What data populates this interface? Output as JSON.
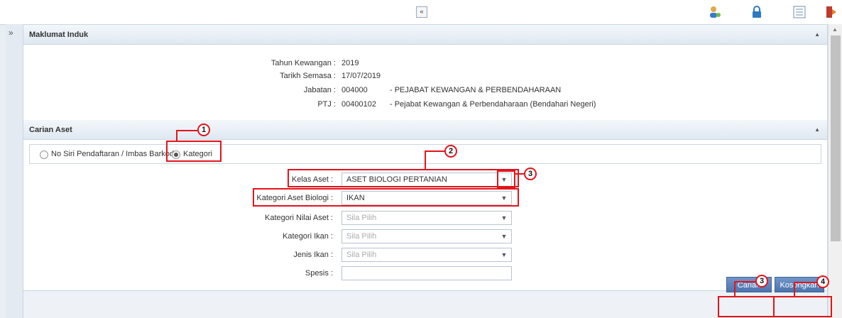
{
  "toolbar": {
    "collapse_symbol": "«",
    "icons": [
      "user-icon",
      "lock-icon",
      "list-icon",
      "logout-icon"
    ]
  },
  "rail": {
    "expand_symbol": "»"
  },
  "maklumat": {
    "title": "Maklumat Induk",
    "rows": [
      {
        "label": "Tahun Kewangan :",
        "code": "2019",
        "desc": ""
      },
      {
        "label": "Tarikh Semasa :",
        "code": "17/07/2019",
        "desc": ""
      },
      {
        "label": "Jabatan :",
        "code": "004000",
        "desc": "- PEJABAT KEWANGAN & PERBENDAHARAAN"
      },
      {
        "label": "PTJ :",
        "code": "00400102",
        "desc": "- Pejabat Kewangan & Perbendaharaan (Bendahari Negeri)"
      }
    ]
  },
  "carian": {
    "title": "Carian Aset",
    "radio_no_siri": "No Siri Pendaftaran / Imbas Barkod",
    "radio_kategori": "Kategori",
    "fields": [
      {
        "label": "Kelas Aset :",
        "value": "ASET BIOLOGI PERTANIAN"
      },
      {
        "label": "Kategori Aset Biologi :",
        "value": "IKAN"
      },
      {
        "label": "Kategori Nilai Aset :",
        "value": "Sila Pilih"
      },
      {
        "label": "Kategori Ikan :",
        "value": "Sila Pilih"
      },
      {
        "label": "Jenis Ikan :",
        "value": "Sila Pilih"
      }
    ],
    "spesis_label": "Spesis :",
    "spesis_value": ""
  },
  "buttons": {
    "carian": "Carian",
    "kosongkan": "Kosongkan"
  },
  "callouts": [
    "1",
    "2",
    "3",
    "3",
    "4"
  ],
  "colors": {
    "accent": "#e3141b",
    "button": "#5a80b8",
    "header": "#dfe8f1"
  }
}
